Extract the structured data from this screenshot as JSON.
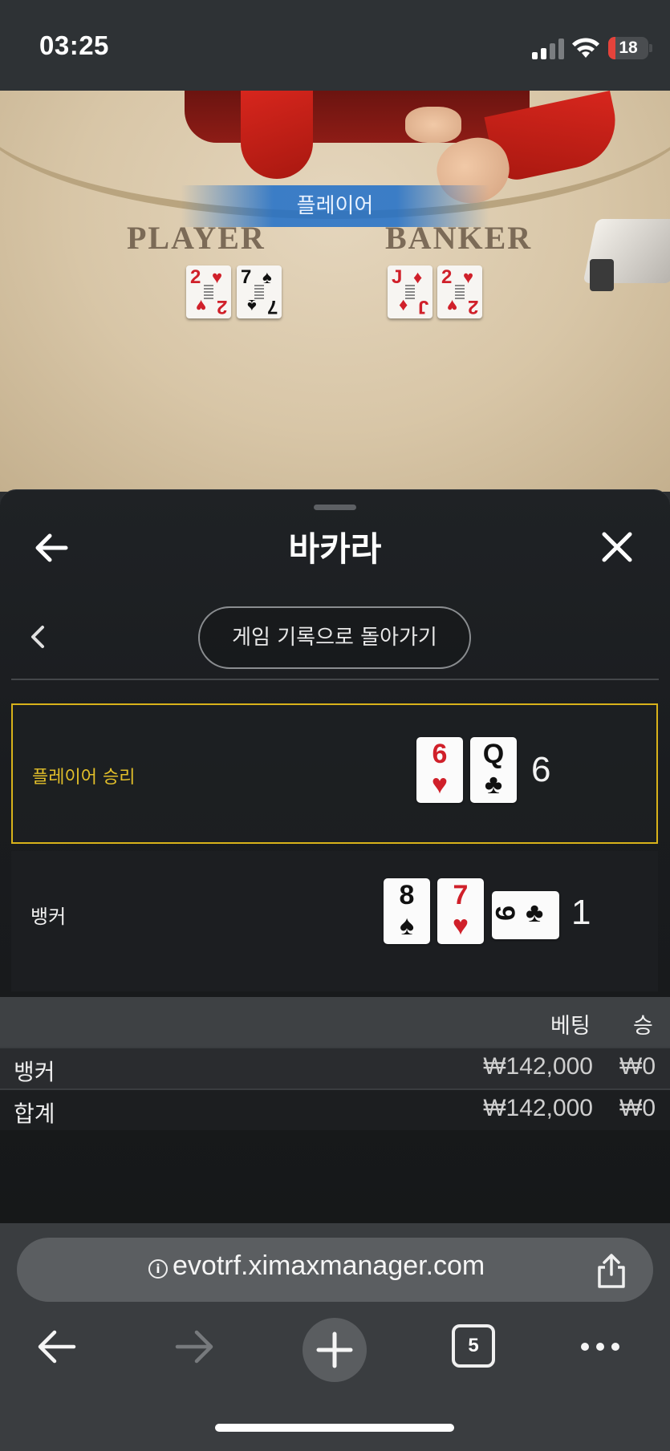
{
  "status_bar": {
    "time": "03:25",
    "battery": "18",
    "battery_level": 0.18
  },
  "video": {
    "banner": "플레이어",
    "player_label": "PLAYER",
    "banker_label": "BANKER",
    "player_cards": [
      {
        "rank": "2",
        "suit": "♥",
        "color": "red"
      },
      {
        "rank": "7",
        "suit": "♠",
        "color": "black"
      }
    ],
    "banker_cards": [
      {
        "rank": "J",
        "suit": "♦",
        "color": "red"
      },
      {
        "rank": "2",
        "suit": "♥",
        "color": "red"
      }
    ]
  },
  "sheet": {
    "title": "바카라",
    "back_to_history": "게임 기록으로 돌아가기",
    "player_row": {
      "label": "플레이어 승리",
      "cards": [
        {
          "rank": "6",
          "suit": "♥",
          "color": "red"
        },
        {
          "rank": "Q",
          "suit": "♣",
          "color": "black"
        }
      ],
      "total": "6"
    },
    "banker_row": {
      "label": "뱅커",
      "cards": [
        {
          "rank": "8",
          "suit": "♠",
          "color": "black"
        },
        {
          "rank": "7",
          "suit": "♥",
          "color": "red"
        },
        {
          "rank": "9",
          "suit": "♣",
          "color": "black",
          "sideways": true
        }
      ],
      "total": "1"
    },
    "bets_table": {
      "headers": {
        "bet": "베팅",
        "win": "승"
      },
      "rows": [
        {
          "label": "뱅커",
          "bet": "₩142,000",
          "win": "₩0"
        },
        {
          "label": "합계",
          "bet": "₩142,000",
          "win": "₩0"
        }
      ]
    },
    "highlight_color": "#d8b21a"
  },
  "browser": {
    "url": "evotrf.ximaxmanager.com",
    "tab_count": "5"
  },
  "icons": [
    "signal-icon",
    "wifi-icon",
    "battery-icon",
    "arrow-left-icon",
    "close-icon",
    "chevron-left-icon",
    "info-icon",
    "share-icon",
    "arrow-right-icon",
    "plus-icon",
    "tabs-icon",
    "more-icon"
  ]
}
